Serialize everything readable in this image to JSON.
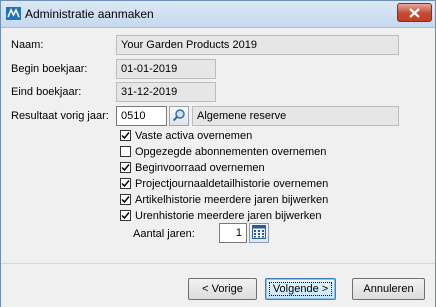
{
  "window": {
    "title": "Administratie aanmaken"
  },
  "form": {
    "naam": {
      "label": "Naam:",
      "value": "Your Garden Products 2019"
    },
    "begin": {
      "label": "Begin boekjaar:",
      "value": "01-01-2019"
    },
    "eind": {
      "label": "Eind boekjaar:",
      "value": "31-12-2019"
    },
    "resultaat": {
      "label": "Resultaat vorig jaar:",
      "code": "0510",
      "description": "Algemene reserve"
    }
  },
  "options": [
    {
      "label": "Vaste activa overnemen",
      "checked": true
    },
    {
      "label": "Opgezegde abonnementen overnemen",
      "checked": false
    },
    {
      "label": "Beginvoorraad overnemen",
      "checked": true
    },
    {
      "label": "Projectjournaaldetailhistorie overnemen",
      "checked": true
    },
    {
      "label": "Artikelhistorie meerdere jaren bijwerken",
      "checked": true
    },
    {
      "label": "Urenhistorie meerdere jaren bijwerken",
      "checked": true
    }
  ],
  "aantal": {
    "label": "Aantal jaren:",
    "value": "1"
  },
  "buttons": {
    "prev": "< Vorige",
    "next": "Volgende >",
    "cancel": "Annuleren"
  },
  "icons": {
    "app": "app-logo-icon",
    "close": "close-icon",
    "search": "magnifier-icon",
    "calendar": "calculator-icon"
  }
}
